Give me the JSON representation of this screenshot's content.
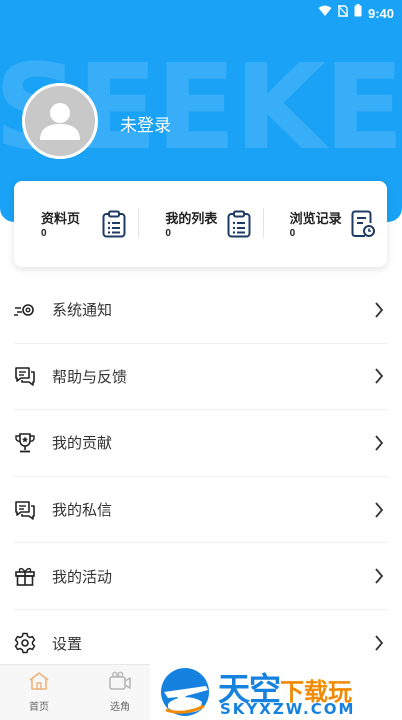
{
  "status_bar": {
    "time": "9:40"
  },
  "header": {
    "watermark": "SEEKER",
    "login_text": "未登录",
    "background_color": "#1aa3f6"
  },
  "stats": [
    {
      "label": "资料页",
      "count": "0",
      "icon": "clipboard-list-icon"
    },
    {
      "label": "我的列表",
      "count": "0",
      "icon": "clipboard-list-icon"
    },
    {
      "label": "浏览记录",
      "count": "0",
      "icon": "document-clock-icon"
    }
  ],
  "menu": [
    {
      "label": "系统通知",
      "icon": "gear-speed-icon"
    },
    {
      "label": "帮助与反馈",
      "icon": "chat-bubbles-icon"
    },
    {
      "label": "我的贡献",
      "icon": "trophy-icon"
    },
    {
      "label": "我的私信",
      "icon": "message-icon"
    },
    {
      "label": "我的活动",
      "icon": "gift-icon"
    },
    {
      "label": "设置",
      "icon": "settings-icon"
    }
  ],
  "bottom_nav": [
    {
      "label": "首页",
      "icon": "home-icon"
    },
    {
      "label": "选角",
      "icon": "video-camera-icon"
    }
  ],
  "watermark_brand": {
    "title_main": "天空",
    "title_sub": "下载玩",
    "domain": "SKYXZW.COM"
  }
}
